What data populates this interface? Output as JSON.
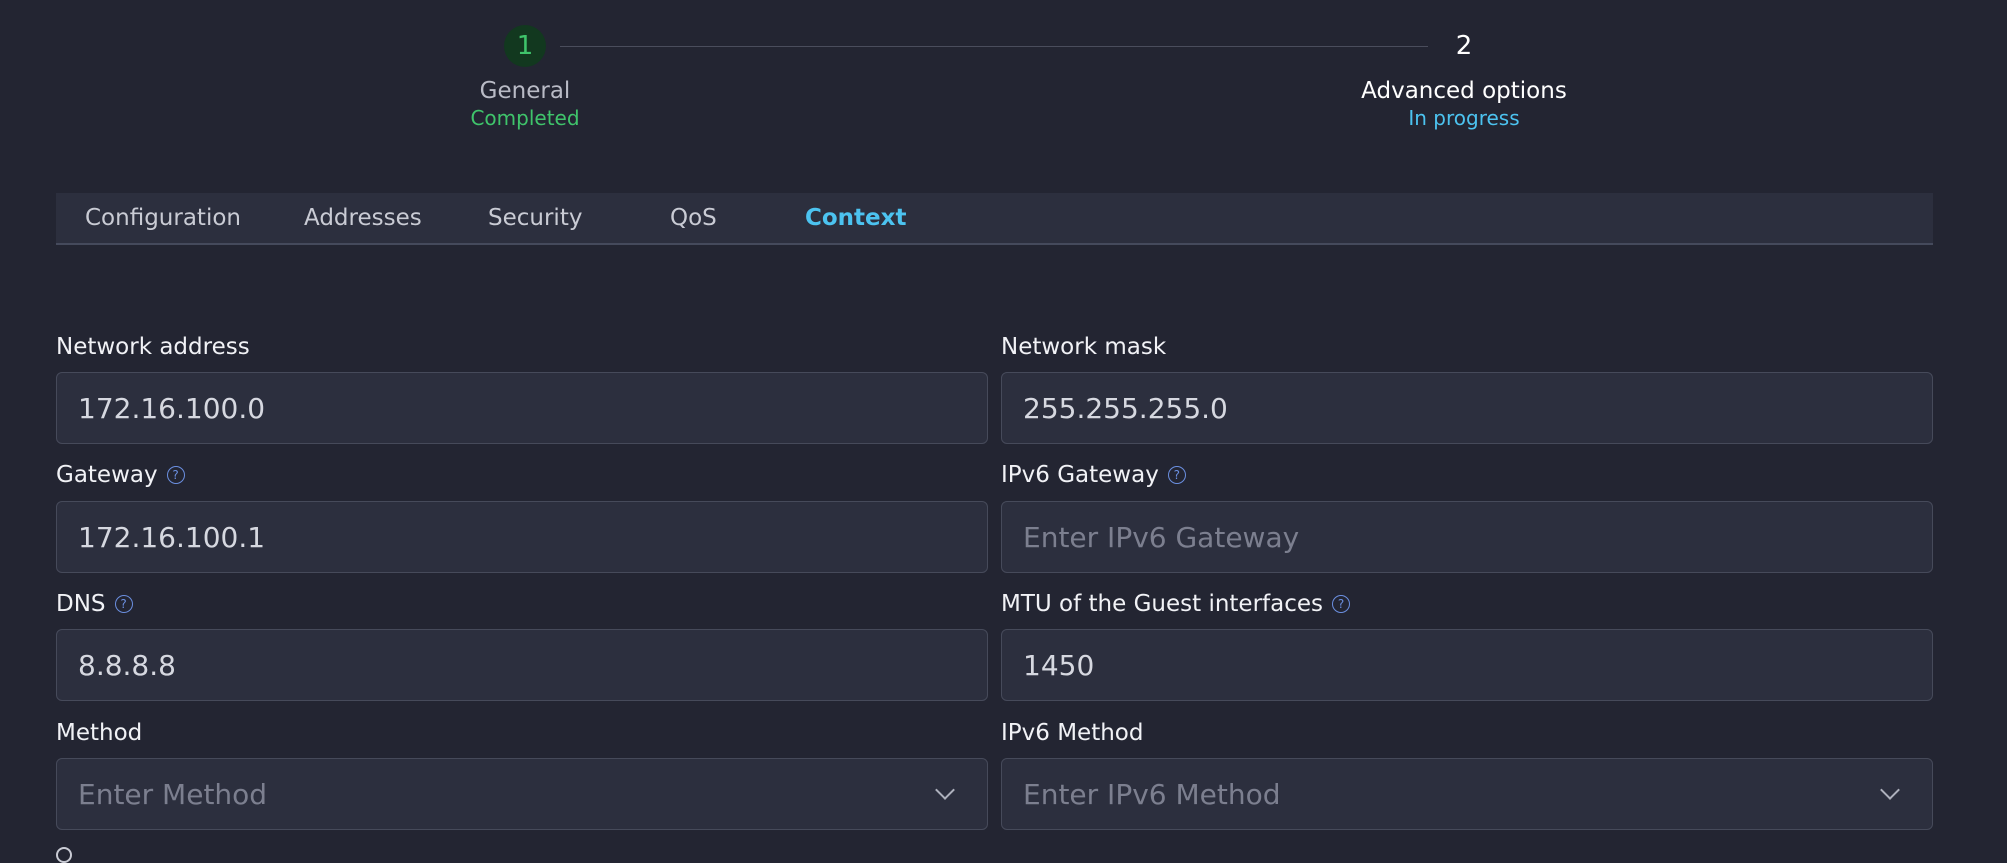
{
  "stepper": {
    "steps": [
      {
        "number": "1",
        "title": "General",
        "status": "Completed"
      },
      {
        "number": "2",
        "title": "Advanced options",
        "status": "In progress"
      }
    ]
  },
  "tabs": [
    {
      "label": "Configuration"
    },
    {
      "label": "Addresses"
    },
    {
      "label": "Security"
    },
    {
      "label": "QoS"
    },
    {
      "label": "Context"
    }
  ],
  "form": {
    "network_address": {
      "label": "Network address",
      "value": "172.16.100.0"
    },
    "network_mask": {
      "label": "Network mask",
      "value": "255.255.255.0"
    },
    "gateway": {
      "label": "Gateway",
      "value": "172.16.100.1"
    },
    "ipv6_gateway": {
      "label": "IPv6 Gateway",
      "value": "",
      "placeholder": "Enter IPv6 Gateway"
    },
    "dns": {
      "label": "DNS",
      "value": "8.8.8.8"
    },
    "mtu": {
      "label": "MTU of the Guest interfaces",
      "value": "1450"
    },
    "method": {
      "label": "Method",
      "placeholder": "Enter Method"
    },
    "ipv6_method": {
      "label": "IPv6 Method",
      "placeholder": "Enter IPv6 Method"
    }
  },
  "icons": {
    "help": "help-circle-icon",
    "chevron": "chevron-down-icon"
  },
  "colors": {
    "background": "#232532",
    "accent": "#4cc3f0",
    "success": "#3fc46b"
  }
}
